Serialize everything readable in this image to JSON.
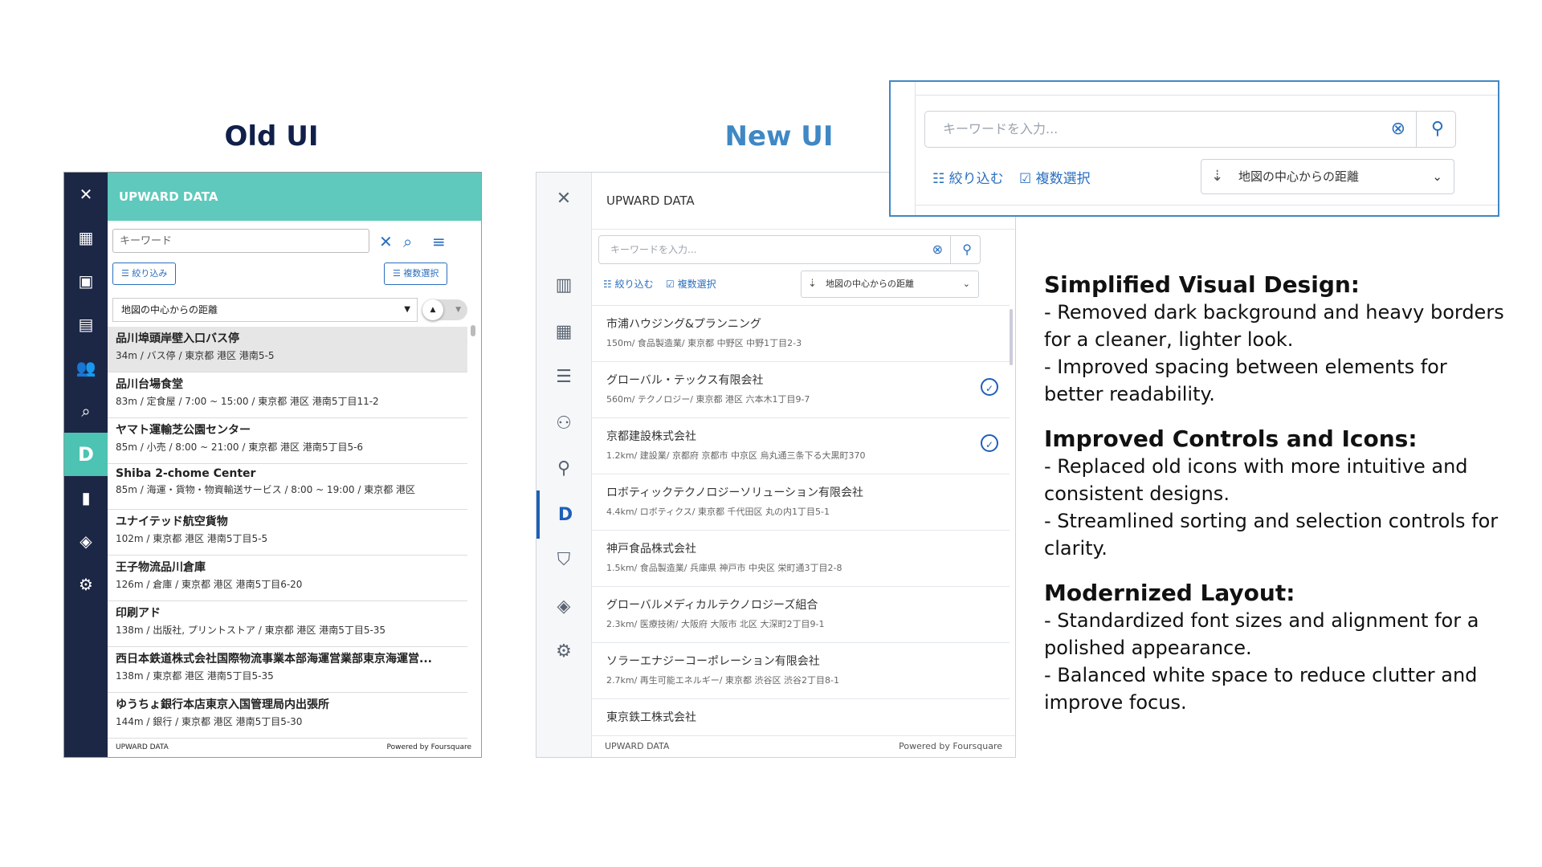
{
  "headings": {
    "old": "Old UI",
    "new": "New UI"
  },
  "old_ui": {
    "rail_icons": [
      "close-icon",
      "dashboard-icon",
      "calendar-icon",
      "clipboard-icon",
      "people-icon",
      "search-list-icon",
      "d-logo-icon",
      "map-icon",
      "layers-icon",
      "gear-icon"
    ],
    "rail_glyphs": [
      "✕",
      "▦",
      "▣",
      "▤",
      "👥",
      "⌕",
      "D",
      "▮",
      "◈",
      "⚙"
    ],
    "header": "UPWARD DATA",
    "search_placeholder": "キーワード",
    "filter_label": "絞り込み",
    "multi_select_label": "複数選択",
    "sort_label": "地図の中心からの距離",
    "items": [
      {
        "name": "品川埠頭岸壁入口バス停",
        "meta": "34m / バス停 / 東京都 港区 港南5-5"
      },
      {
        "name": "品川台場食堂",
        "meta": "83m / 定食屋 / 7:00 ~ 15:00 / 東京都 港区 港南5丁目11-2"
      },
      {
        "name": "ヤマト運輸芝公園センター",
        "meta": "85m / 小売 / 8:00 ~ 21:00 / 東京都 港区 港南5丁目5-6"
      },
      {
        "name": "Shiba 2-chome Center",
        "meta": "85m / 海運・貨物・物資輸送サービス / 8:00 ~ 19:00 / 東京都 港区"
      },
      {
        "name": "ユナイテッド航空貨物",
        "meta": "102m / 東京都 港区 港南5丁目5-5"
      },
      {
        "name": "王子物流品川倉庫",
        "meta": "126m / 倉庫 / 東京都 港区 港南5丁目6-20"
      },
      {
        "name": "印刷アド",
        "meta": "138m / 出版社, プリントストア / 東京都 港区 港南5丁目5-35"
      },
      {
        "name": "西日本鉄道株式会社国際物流事業本部海運営業部東京海運営...",
        "meta": "138m / 東京都 港区 港南5丁目5-35"
      },
      {
        "name": "ゆうちょ銀行本店東京入国管理局内出張所",
        "meta": "144m / 銀行 / 東京都 港区 港南5丁目5-30"
      }
    ],
    "footer_left": "UPWARD DATA",
    "footer_right": "Powered by Foursquare"
  },
  "new_ui": {
    "rail_icons": [
      "close-icon",
      "bar-chart-icon",
      "calendar-icon",
      "checklist-icon",
      "people-icon",
      "search-icon",
      "d-logo-icon",
      "map-pin-icon",
      "layers-icon",
      "gear-icon"
    ],
    "rail_glyphs": [
      "✕",
      "▥",
      "▦",
      "☰",
      "⚇",
      "⚲",
      "D",
      "⛉",
      "◈",
      "⚙"
    ],
    "header": "UPWARD DATA",
    "search_placeholder": "キーワードを入力...",
    "filter_label": "絞り込む",
    "multi_select_label": "複数選択",
    "sort_label": "地図の中心からの距離",
    "items": [
      {
        "name": "市浦ハウジング&プランニング",
        "meta": "150m/ 食品製造業/ 東京都 中野区 中野1丁目2-3",
        "checked": false
      },
      {
        "name": "グローバル・テックス有限会社",
        "meta": "560m/ テクノロジー/ 東京都 港区 六本木1丁目9-7",
        "checked": true
      },
      {
        "name": "京都建設株式会社",
        "meta": "1.2km/ 建設業/ 京都府 京都市 中京区 烏丸通三条下る大黒町370",
        "checked": true
      },
      {
        "name": "ロボティックテクノロジーソリューション有限会社",
        "meta": "4.4km/ ロボティクス/ 東京都 千代田区 丸の内1丁目5-1",
        "checked": false
      },
      {
        "name": "神戸食品株式会社",
        "meta": "1.5km/ 食品製造業/ 兵庫県 神戸市 中央区 栄町通3丁目2-8",
        "checked": false
      },
      {
        "name": "グローバルメディカルテクノロジーズ組合",
        "meta": "2.3km/ 医療技術/ 大阪府 大阪市 北区 大深町2丁目9-1",
        "checked": false
      },
      {
        "name": "ソラーエナジーコーポレーション有限会社",
        "meta": "2.7km/ 再生可能エネルギー/ 東京都 渋谷区 渋谷2丁目8-1",
        "checked": false
      },
      {
        "name": "東京鉄工株式会社",
        "meta": "",
        "checked": false
      }
    ],
    "footer_left": "UPWARD DATA",
    "footer_right": "Powered by Foursquare"
  },
  "zoom": {
    "search_placeholder": "キーワードを入力...",
    "filter_label": "絞り込む",
    "multi_select_label": "複数選択",
    "sort_label": "地図の中心からの距離"
  },
  "notes": [
    {
      "title": "Simplified Visual Design",
      "lines": [
        "- Removed dark background and heavy borders for a cleaner, lighter look.",
        "- Improved spacing between elements for better readability."
      ]
    },
    {
      "title": "Improved Controls and Icons",
      "lines": [
        "- Replaced old icons with more intuitive and consistent designs.",
        "- Streamlined sorting and selection controls for clarity."
      ]
    },
    {
      "title": "Modernized Layout",
      "lines": [
        "- Standardized font sizes and alignment for a polished appearance.",
        "- Balanced white space to reduce clutter and improve focus."
      ]
    }
  ],
  "colors": {
    "old_rail": "#1c2746",
    "old_header": "#5ec9bc",
    "accent_blue": "#2a6fbe",
    "new_title": "#3f88c5"
  }
}
